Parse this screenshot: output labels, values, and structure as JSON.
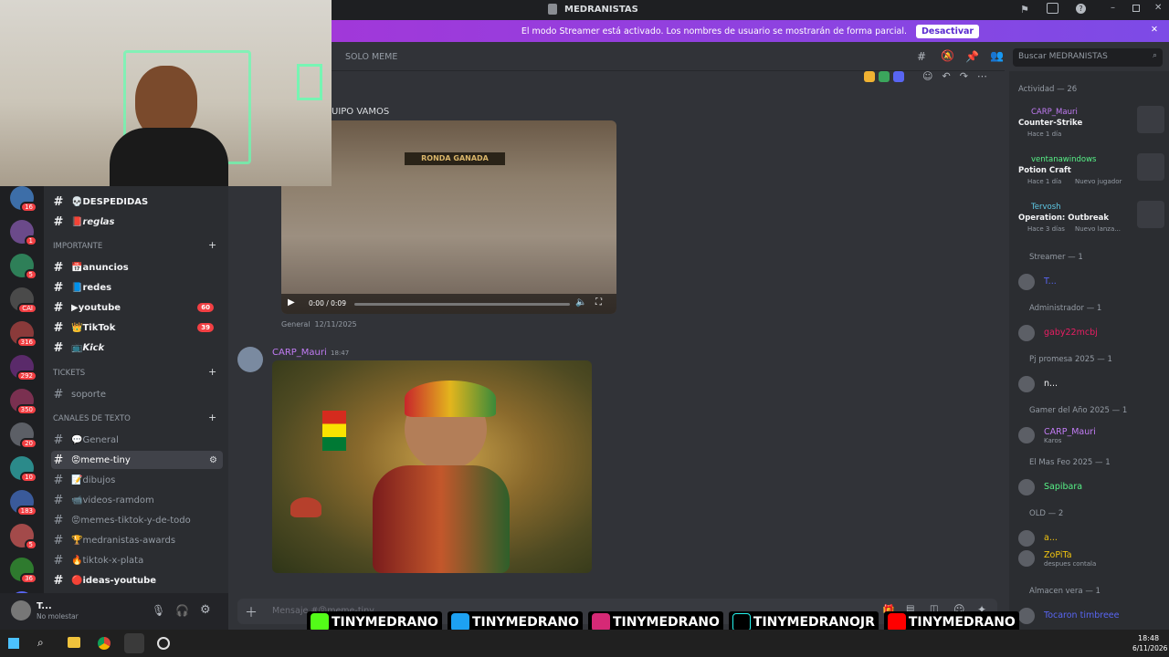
{
  "app": {
    "title": "MEDRANISTAS"
  },
  "banner": {
    "text": "El modo Streamer está activado. Los nombres de usuario se mostrarán de forma parcial.",
    "button": "Desactivar"
  },
  "channel_header": {
    "name": "SOLO MEME",
    "search_placeholder": "Buscar MEDRANISTAS"
  },
  "guild_badges": [
    "16",
    "1",
    "5",
    "CAI",
    "316",
    "292",
    "350",
    "20",
    "10",
    "183",
    "5",
    "36",
    "NUEVO"
  ],
  "channels": {
    "items": [
      {
        "label": "💀DESPEDIDAS",
        "bold": true
      },
      {
        "label": "📕𝙧𝙚𝙜𝙡𝙖𝙨",
        "bold": true
      }
    ],
    "cat_importante": "IMPORTANTE",
    "importante": [
      {
        "label": "📅anuncios",
        "bold": true
      },
      {
        "label": "📘redes",
        "bold": true
      },
      {
        "label": "▶youtube",
        "bold": true,
        "count": "60"
      },
      {
        "label": "👑TikTok",
        "bold": true,
        "count": "39"
      },
      {
        "label": "📺𝙆𝙞𝙘𝙠",
        "bold": true
      }
    ],
    "cat_tickets": "Tickets",
    "tickets": [
      {
        "label": "soporte"
      }
    ],
    "cat_texto": "CANALES DE TEXTO",
    "texto": [
      {
        "label": "💬General"
      },
      {
        "label": "😡meme-tiny",
        "active": true
      },
      {
        "label": "📝dibujos"
      },
      {
        "label": "📹videos-ramdom"
      },
      {
        "label": "😡memes-tiktok-y-de-todo"
      },
      {
        "label": "🏆medranistas-awards"
      },
      {
        "label": "🔥tiktok-x-plata"
      },
      {
        "label": "🔴ideas-youtube",
        "bold": true
      }
    ]
  },
  "user": {
    "name": "T...",
    "status": "No molestar"
  },
  "messages": {
    "m1_text": "UIPO VAMOS",
    "video_time": "0:00 / 0:09",
    "video_overlay": "RONDA GANADA",
    "m1_footer_channel": "General",
    "m1_footer_date": "12/11/2025",
    "m2_author": "CARP_Mauri",
    "m2_time": "18:47"
  },
  "composer": {
    "placeholder": "Mensaje #😡meme-tiny"
  },
  "members": {
    "activity_title": "Actividad — 26",
    "activities": [
      {
        "name": "CARP_Mauri",
        "game": "Counter-Strike",
        "when": "Hace 1 día",
        "extra": ""
      },
      {
        "name": "ventanawindows",
        "game": "Potion Craft",
        "when": "Hace 1 día",
        "extra": "Nuevo jugador"
      },
      {
        "name": "Tervosh",
        "game": "Operation: Outbreak",
        "when": "Hace 3 días",
        "extra": "Nuevo lanza..."
      }
    ],
    "groups": [
      {
        "title": "Streamer — 1",
        "members": [
          {
            "name": "T...",
            "color": "#5865f2",
            "sub": ""
          }
        ]
      },
      {
        "title": "Administrador — 1",
        "members": [
          {
            "name": "gaby22mcbj",
            "color": "#e91e63",
            "sub": ""
          }
        ]
      },
      {
        "title": "Pj promesa 2025 — 1",
        "members": [
          {
            "name": "n...",
            "color": "#f2f3f5",
            "sub": ""
          }
        ]
      },
      {
        "title": "Gamer del Año 2025 — 1",
        "members": [
          {
            "name": "CARP_Mauri",
            "color": "#c27cf5",
            "sub": "Karos"
          }
        ]
      },
      {
        "title": "El Mas Feo 2025 — 1",
        "members": [
          {
            "name": "Sapibara",
            "color": "#57f287",
            "sub": ""
          }
        ]
      },
      {
        "title": "OLD — 2",
        "members": [
          {
            "name": "a...",
            "color": "#f1c40f",
            "sub": ""
          },
          {
            "name": "ZoPiTa",
            "color": "#f1c40f",
            "sub": "despues contala"
          }
        ]
      },
      {
        "title": "Almacen vera — 1",
        "members": [
          {
            "name": "Tocaron timbreee",
            "color": "#5865f2",
            "sub": ""
          }
        ]
      }
    ]
  },
  "watermark": {
    "items": [
      "TINYMEDRANO",
      "TINYMEDRANO",
      "TINYMEDRANO",
      "TINYMEDRANOJR",
      "TINYMEDRANO"
    ]
  },
  "taskbar": {
    "time": "18:48",
    "date": "6/11/2026"
  }
}
